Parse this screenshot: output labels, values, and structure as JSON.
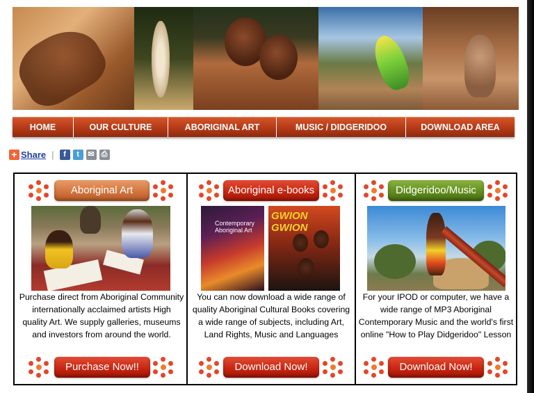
{
  "nav": {
    "items": [
      "HOME",
      "OUR CULTURE",
      "ABORIGINAL ART",
      "MUSIC / DIDGERIDOO",
      "DOWNLOAD AREA"
    ]
  },
  "share": {
    "plus": "+",
    "label": "Share",
    "separator": "|"
  },
  "sections": [
    {
      "header": "Aboriginal Art",
      "header_color": "#d8783f",
      "text": "Purchase direct from Aboriginal Community internationally acclaimed artists High quality Art. We supply galleries, museums and investors from around the world.",
      "button": "Purchase Now!!"
    },
    {
      "header": "Aboriginal e-books",
      "header_color": "#c9321a",
      "text": "You can now download a wide range of quality Aboriginal Cultural Books covering a wide range of subjects, including Art, Land Rights, Music and Languages",
      "button": "Download  Now!",
      "book1_title": "Contemporary\nAboriginal Art",
      "book2_title": "GWION GWION"
    },
    {
      "header": "Didgeridoo/Music",
      "header_color": "#5e8a1c",
      "text": "For your IPOD or computer, we have a wide range of MP3 Aboriginal Contemporary Music and the world's first online \"How to Play Didgeridoo\" Lesson",
      "button": "Download  Now!"
    }
  ],
  "colors": {
    "nav": "#b33a16",
    "accent_dot": "#e4462a",
    "link": "#1a3fa8"
  },
  "icons": [
    "share-plus-icon",
    "facebook-icon",
    "twitter-icon",
    "email-icon",
    "print-icon",
    "dot-cluster-icon"
  ]
}
